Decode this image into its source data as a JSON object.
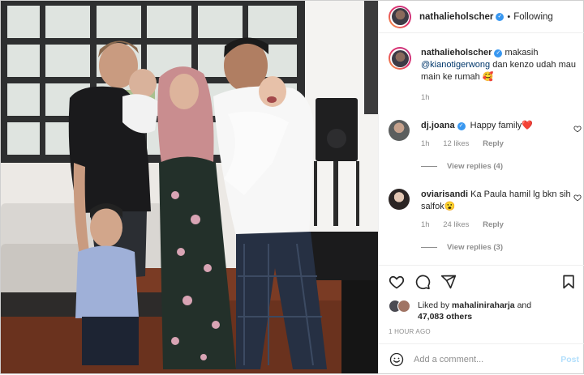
{
  "post": {
    "username": "nathalieholscher",
    "follow_status": "Following",
    "caption_user": "nathalieholscher",
    "caption_mention": "@kianotigerwong",
    "caption_text": "dan kenzo udah mau main ke rumah 🥰",
    "caption_prefix": "makasih",
    "caption_age": "1h"
  },
  "comments": [
    {
      "user": "dj.joana",
      "verified": true,
      "text": "Happy family❤️",
      "age": "1h",
      "likes": "12 likes",
      "reply_label": "Reply",
      "view_replies": "View replies (4)"
    },
    {
      "user": "oviarisandi",
      "verified": false,
      "text": "Ka Paula hamil lg bkn sih salfok😮",
      "age": "1h",
      "likes": "24 likes",
      "reply_label": "Reply",
      "view_replies": "View replies (3)"
    }
  ],
  "likes": {
    "prefix": "Liked by",
    "user": "mahaliniraharja",
    "joiner": "and",
    "others": "47,083 others"
  },
  "timestamp": "1 HOUR AGO",
  "add_comment": {
    "placeholder": "Add a comment...",
    "post_label": "Post"
  },
  "icons": [
    "heart-icon",
    "comment-icon",
    "share-icon",
    "bookmark-icon",
    "emoji-icon",
    "verified-icon"
  ],
  "colors": {
    "verified": "#3897f0",
    "link": "#00376b",
    "muted": "#8e8e8e",
    "post_disabled": "#b2dffc",
    "heart": "#ed4956"
  }
}
